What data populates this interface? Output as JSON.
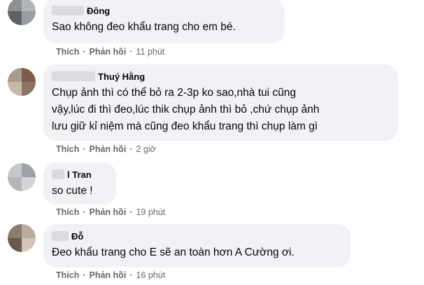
{
  "colors": {
    "bubble": "#f0f2f5",
    "text": "#050505",
    "meta": "#65676b"
  },
  "comments": [
    {
      "author": "Đông",
      "text_lines": [
        "Sao không đeo khẩu trang cho em bé."
      ],
      "actions": {
        "like": "Thích",
        "reply": "Phản hồi",
        "time": "11 phút"
      }
    },
    {
      "author": "Thuý Hằng",
      "text_lines": [
        "Chụp ảnh thì có thể bỏ ra 2-3p ko sao,nhà tui cũng",
        "vậy,lúc đi thì đeo,lúc thik chụp ảnh thì bỏ ,chứ chụp ảnh",
        "lưu giữ kỉ niệm mà cũng đeo khẩu trang thì chụp làm gì"
      ],
      "actions": {
        "like": "Thích",
        "reply": "Phản hồi",
        "time": "2 giờ"
      }
    },
    {
      "author": "l Tran",
      "text_lines": [
        "so cute !"
      ],
      "actions": {
        "like": "Thích",
        "reply": "Phản hồi",
        "time": "19 phút"
      }
    },
    {
      "author": "Đỗ",
      "text_lines": [
        "Đeo khẩu trang cho E sẽ an toàn hơn A Cường ơi."
      ],
      "actions": {
        "like": "Thích",
        "reply": "Phản hồi",
        "time": "16 phút"
      }
    }
  ]
}
